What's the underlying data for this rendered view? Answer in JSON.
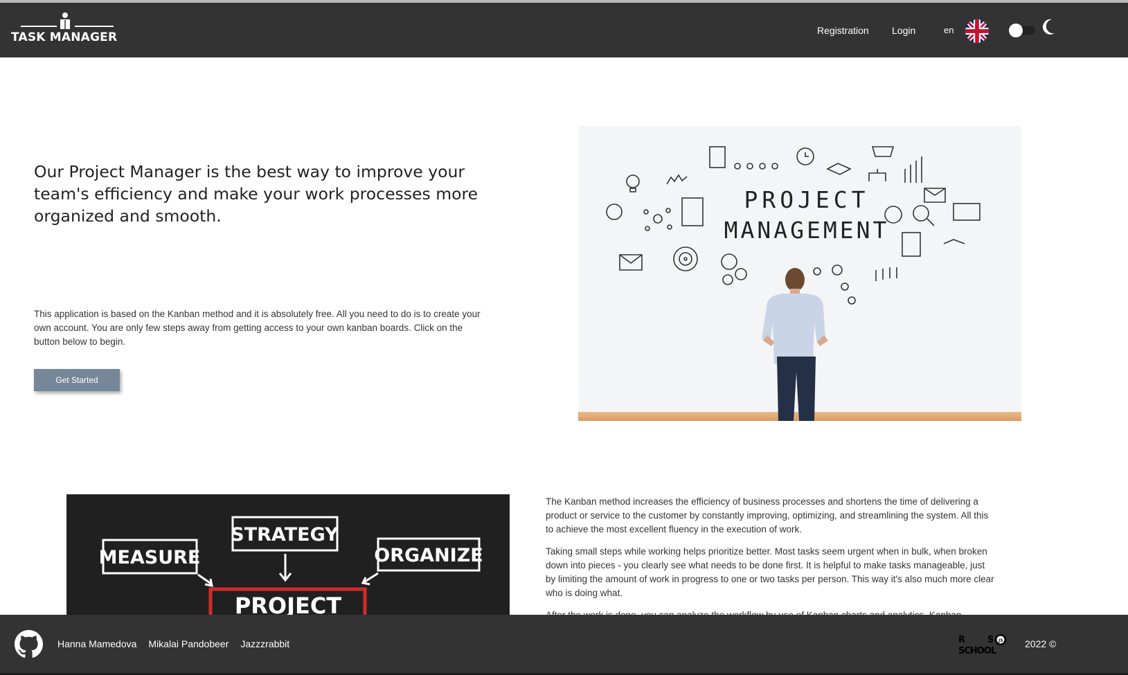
{
  "header": {
    "logo_text": "TASK MANAGER",
    "nav": {
      "registration": "Registration",
      "login": "Login",
      "language": "en"
    },
    "flag_icon": "uk-flag-icon",
    "theme_toggle": "theme-toggle",
    "theme_icon": "moon-icon"
  },
  "hero": {
    "title": "Our Project Manager is the best way to improve your team's efficiency and make your work processes more organized and smooth.",
    "description": "This application is based on the Kanban method and it is absolutely free. All you need to do is to create your own account. You are only few steps away from getting access to your own kanban boards. Click on the button below to begin.",
    "cta": "Get Started",
    "image_text_line1": "PROJECT",
    "image_text_line2": "MANAGEMENT"
  },
  "kanban": {
    "image_labels": [
      "MEASURE",
      "STRATEGY",
      "ORGANIZE",
      "PROJECT"
    ],
    "paragraphs": [
      "The Kanban method increases the efficiency of business processes and shortens the time of delivering a product or service to the customer by constantly improving, optimizing, and streamlining the system. All this to achieve the most excellent fluency in the execution of work.",
      "Taking small steps while working helps prioritize better. Most tasks seem urgent when in bulk, when broken down into pieces - you clearly see what needs to be done first. It is helpful to make tasks manageable, just by limiting the amount of work in progress to one or two tasks per person. This way it's also much more clear who is doing what.",
      "After the work is done, you can analyze the workflow by use of Kanban charts and analytics. Kanban"
    ]
  },
  "footer": {
    "authors": [
      "Hanna Mamedova",
      "Mikalai Pandobeer",
      "Jazzzrabbit"
    ],
    "github_icon": "github-icon",
    "school_logo": "rs-school-logo",
    "copyright": "2022 ©"
  },
  "colors": {
    "header_bg": "#333333",
    "button_bg": "#77879a",
    "footer_bg": "#333333"
  }
}
